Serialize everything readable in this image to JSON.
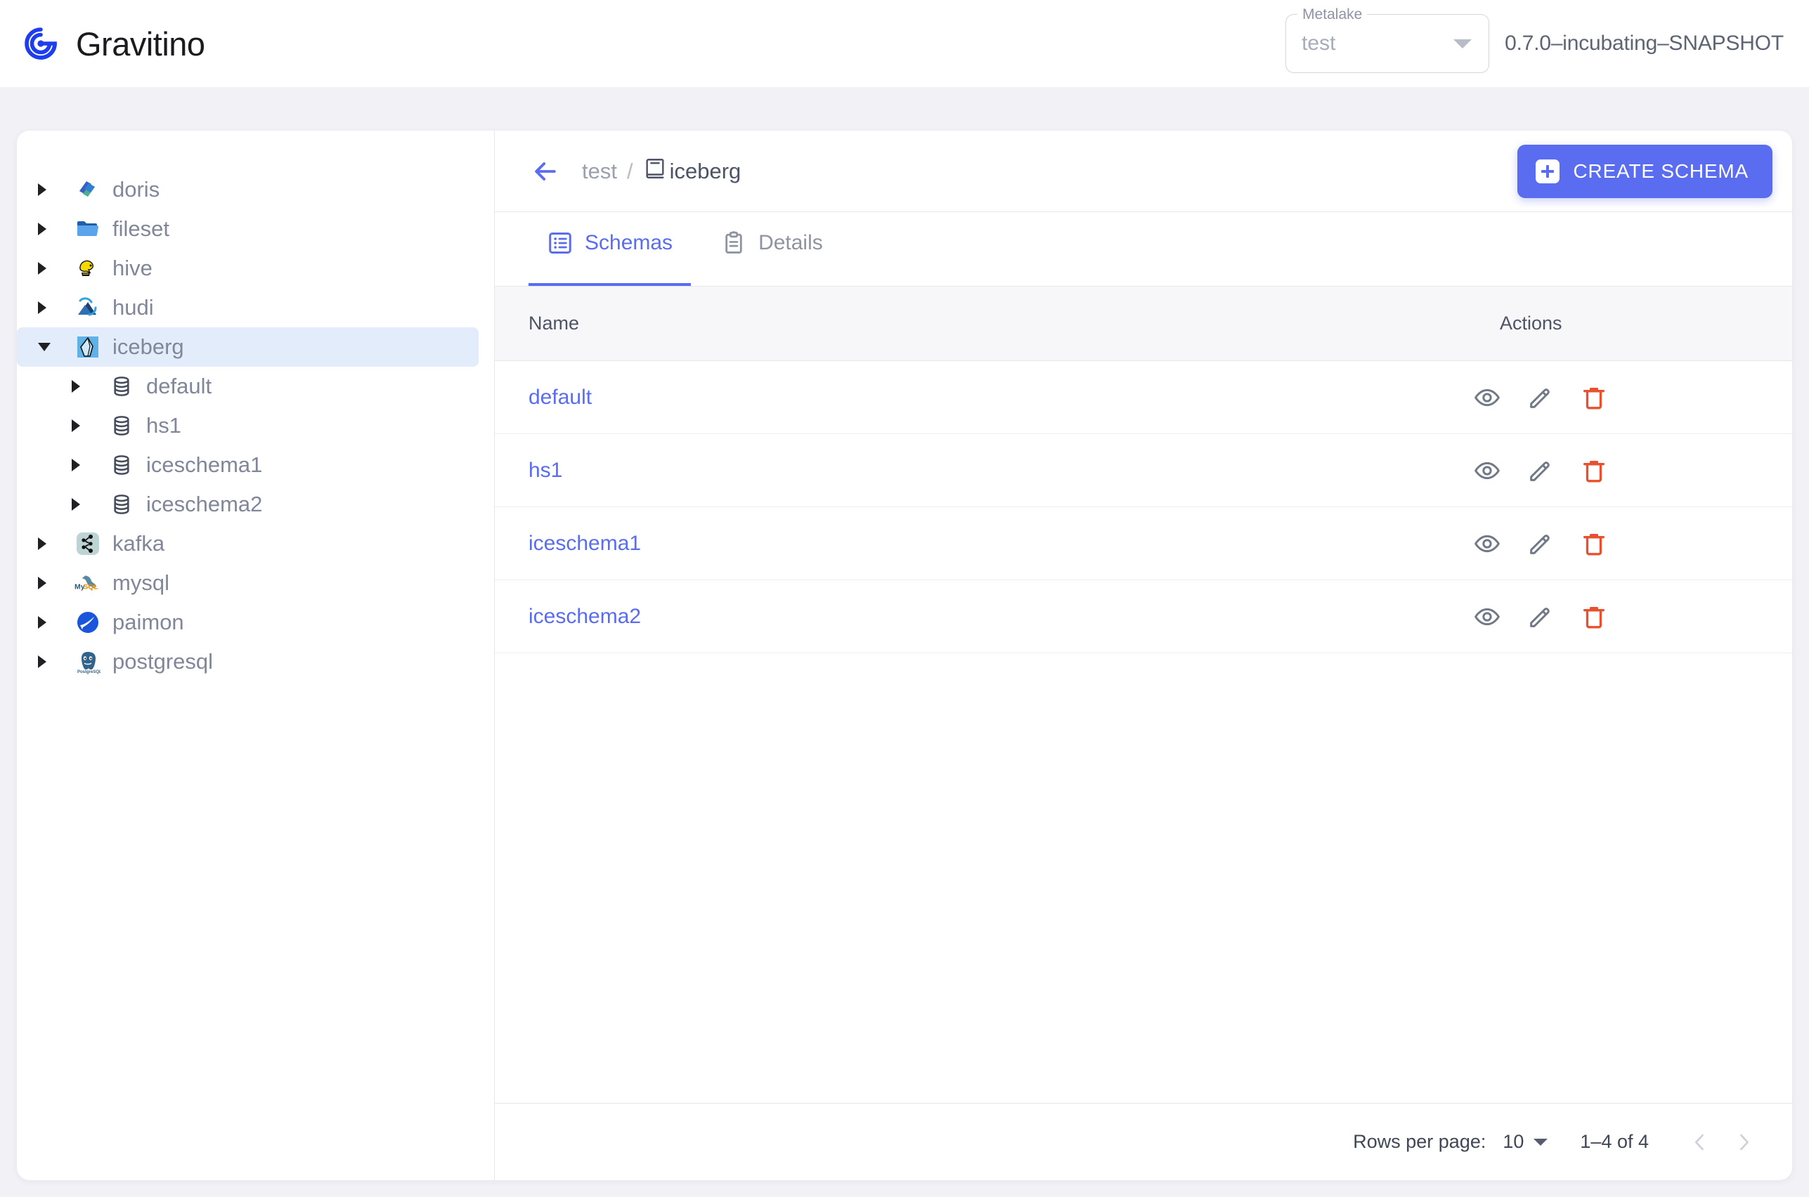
{
  "header": {
    "brand_name": "Gravitino",
    "brand_logo_icon": "gravitino-logo",
    "metalake": {
      "label": "Metalake",
      "value": "test",
      "caret_icon": "chevron-down-icon"
    },
    "version": "0.7.0–incubating–SNAPSHOT"
  },
  "sidebar": {
    "items": [
      {
        "label": "doris",
        "icon": "doris-icon",
        "level": 0,
        "expanded": false,
        "selected": false
      },
      {
        "label": "fileset",
        "icon": "folder-icon",
        "level": 0,
        "expanded": false,
        "selected": false
      },
      {
        "label": "hive",
        "icon": "hive-icon",
        "level": 0,
        "expanded": false,
        "selected": false
      },
      {
        "label": "hudi",
        "icon": "hudi-icon",
        "level": 0,
        "expanded": false,
        "selected": false
      },
      {
        "label": "iceberg",
        "icon": "iceberg-icon",
        "level": 0,
        "expanded": true,
        "selected": true
      },
      {
        "label": "default",
        "icon": "database-icon",
        "level": 1,
        "expanded": false,
        "selected": false
      },
      {
        "label": "hs1",
        "icon": "database-icon",
        "level": 1,
        "expanded": false,
        "selected": false
      },
      {
        "label": "iceschema1",
        "icon": "database-icon",
        "level": 1,
        "expanded": false,
        "selected": false
      },
      {
        "label": "iceschema2",
        "icon": "database-icon",
        "level": 1,
        "expanded": false,
        "selected": false
      },
      {
        "label": "kafka",
        "icon": "kafka-icon",
        "level": 0,
        "expanded": false,
        "selected": false
      },
      {
        "label": "mysql",
        "icon": "mysql-icon",
        "level": 0,
        "expanded": false,
        "selected": false
      },
      {
        "label": "paimon",
        "icon": "paimon-icon",
        "level": 0,
        "expanded": false,
        "selected": false
      },
      {
        "label": "postgresql",
        "icon": "postgresql-icon",
        "level": 0,
        "expanded": false,
        "selected": false
      }
    ]
  },
  "toolbar": {
    "back_icon": "arrow-left-icon",
    "breadcrumb": {
      "metalake": "test",
      "separator": "/",
      "catalog": "iceberg",
      "catalog_icon": "book-icon"
    },
    "create_schema_label": "CREATE SCHEMA",
    "create_schema_icon": "plus-icon"
  },
  "tabs": [
    {
      "label": "Schemas",
      "icon": "list-icon",
      "active": true
    },
    {
      "label": "Details",
      "icon": "clipboard-icon",
      "active": false
    }
  ],
  "table": {
    "columns": [
      "Name",
      "Actions"
    ],
    "rows": [
      {
        "name": "default"
      },
      {
        "name": "hs1"
      },
      {
        "name": "iceschema1"
      },
      {
        "name": "iceschema2"
      }
    ],
    "row_actions": [
      {
        "name": "view",
        "icon": "eye-icon"
      },
      {
        "name": "edit",
        "icon": "pencil-icon"
      },
      {
        "name": "delete",
        "icon": "trash-icon"
      }
    ]
  },
  "pagination": {
    "rows_per_page_label": "Rows per page:",
    "rows_per_page_value": "10",
    "range_text": "1–4 of 4",
    "prev_icon": "chevron-left-icon",
    "next_icon": "chevron-right-icon"
  },
  "colors": {
    "accent": "#5a6cf0",
    "danger": "#e8502e",
    "page_bg": "#f1f1f6",
    "selected_row_bg": "#e3ecfb",
    "muted_text": "#808799"
  }
}
